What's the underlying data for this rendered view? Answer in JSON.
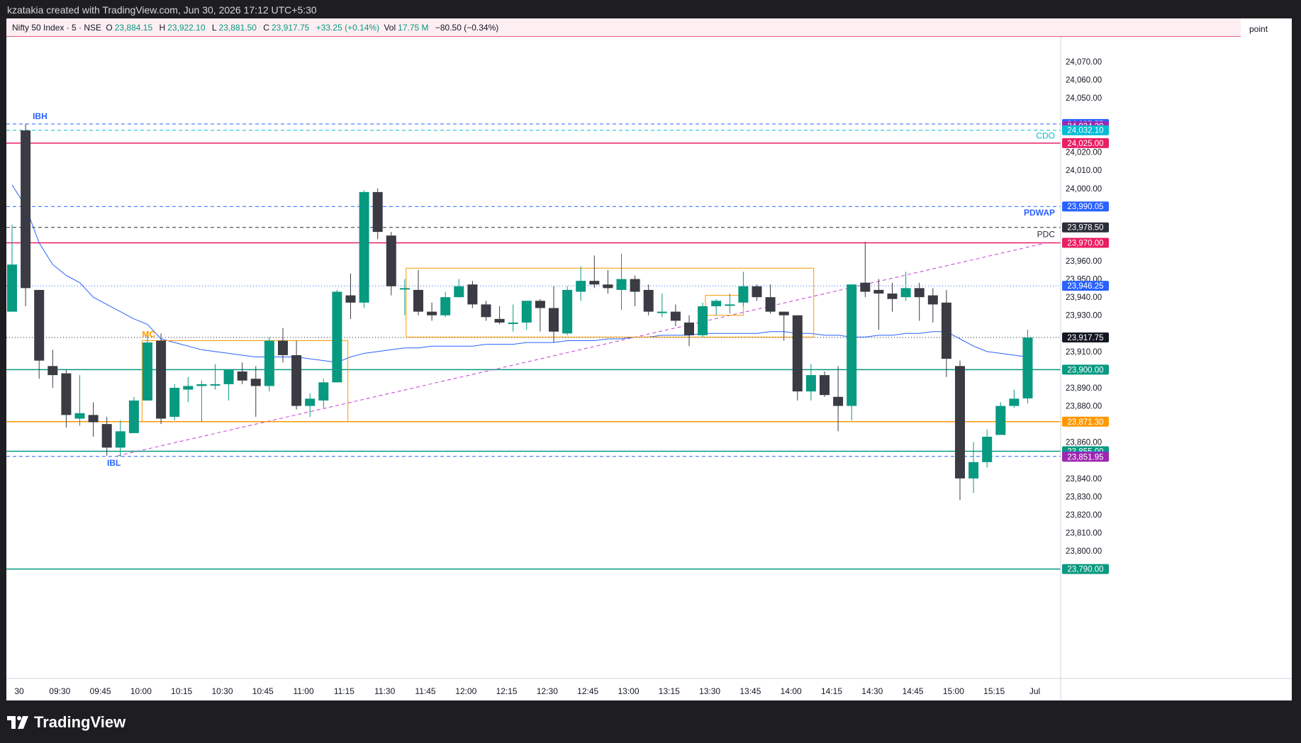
{
  "header": {
    "caption": "kzatakia created with TradingView.com, Jun 30, 2026 17:12 UTC+5:30"
  },
  "legend": {
    "symbol": "Nifty 50 Index · 5 · NSE",
    "o_label": "O",
    "o": "23,884.15",
    "h_label": "H",
    "h": "23,922.10",
    "l_label": "L",
    "l": "23,881.50",
    "c_label": "C",
    "c": "23,917.75",
    "change": "+33.25 (+0.14%)",
    "vol_label": "Vol",
    "vol": "17.75 M",
    "vol_change": "−80.50 (−0.34%)"
  },
  "axis_unit": "point",
  "brand": {
    "name": "TradingView"
  },
  "chart_data": {
    "type": "candlestick",
    "title": "Nifty 50 Index · 5 · NSE",
    "ylim": [
      23784,
      24084
    ],
    "y_ticks": [
      {
        "value": 24070,
        "label": "24,070.00"
      },
      {
        "value": 24060,
        "label": "24,060.00"
      },
      {
        "value": 24050,
        "label": "24,050.00"
      },
      {
        "value": 24020,
        "label": "24,020.00"
      },
      {
        "value": 24010,
        "label": "24,010.00"
      },
      {
        "value": 24000,
        "label": "24,000.00"
      },
      {
        "value": 23960,
        "label": "23,960.00"
      },
      {
        "value": 23950,
        "label": "23,950.00"
      },
      {
        "value": 23940,
        "label": "23,940.00"
      },
      {
        "value": 23930,
        "label": "23,930.00"
      },
      {
        "value": 23910,
        "label": "23,910.00"
      },
      {
        "value": 23890,
        "label": "23,890.00"
      },
      {
        "value": 23880,
        "label": "23,880.00"
      },
      {
        "value": 23860,
        "label": "23,860.00"
      },
      {
        "value": 23840,
        "label": "23,840.00"
      },
      {
        "value": 23830,
        "label": "23,830.00"
      },
      {
        "value": 23820,
        "label": "23,820.00"
      },
      {
        "value": 23810,
        "label": "23,810.00"
      },
      {
        "value": 23800,
        "label": "23,800.00"
      }
    ],
    "x_ticks": [
      {
        "index": 0,
        "label": "30"
      },
      {
        "index": 3,
        "label": "09:30"
      },
      {
        "index": 6,
        "label": "09:45"
      },
      {
        "index": 9,
        "label": "10:00"
      },
      {
        "index": 12,
        "label": "10:15"
      },
      {
        "index": 15,
        "label": "10:30"
      },
      {
        "index": 18,
        "label": "10:45"
      },
      {
        "index": 21,
        "label": "11:00"
      },
      {
        "index": 24,
        "label": "11:15"
      },
      {
        "index": 27,
        "label": "11:30"
      },
      {
        "index": 30,
        "label": "11:45"
      },
      {
        "index": 33,
        "label": "12:00"
      },
      {
        "index": 36,
        "label": "12:15"
      },
      {
        "index": 39,
        "label": "12:30"
      },
      {
        "index": 42,
        "label": "12:45"
      },
      {
        "index": 45,
        "label": "13:00"
      },
      {
        "index": 48,
        "label": "13:15"
      },
      {
        "index": 51,
        "label": "13:30"
      },
      {
        "index": 54,
        "label": "13:45"
      },
      {
        "index": 57,
        "label": "14:00"
      },
      {
        "index": 60,
        "label": "14:15"
      },
      {
        "index": 63,
        "label": "14:30"
      },
      {
        "index": 66,
        "label": "14:45"
      },
      {
        "index": 69,
        "label": "15:00"
      },
      {
        "index": 72,
        "label": "15:15"
      },
      {
        "index": 75,
        "label": "Jul"
      }
    ],
    "candles": [
      {
        "t": "09:15",
        "o": 23932,
        "h": 23980,
        "l": 23932,
        "c": 23958
      },
      {
        "t": "09:20",
        "o": 24032,
        "h": 24035.55,
        "l": 23935,
        "c": 23945
      },
      {
        "t": "09:25",
        "o": 23944,
        "h": 23944,
        "l": 23895,
        "c": 23905
      },
      {
        "t": "09:30",
        "o": 23902,
        "h": 23911,
        "l": 23890,
        "c": 23897
      },
      {
        "t": "09:35",
        "o": 23898,
        "h": 23900,
        "l": 23868,
        "c": 23875
      },
      {
        "t": "09:40",
        "o": 23873,
        "h": 23897,
        "l": 23869,
        "c": 23876
      },
      {
        "t": "09:45",
        "o": 23875,
        "h": 23882,
        "l": 23863,
        "c": 23871
      },
      {
        "t": "09:50",
        "o": 23870,
        "h": 23874,
        "l": 23852.5,
        "c": 23857
      },
      {
        "t": "09:55",
        "o": 23857,
        "h": 23872,
        "l": 23851.95,
        "c": 23866
      },
      {
        "t": "10:00",
        "o": 23865,
        "h": 23885,
        "l": 23865,
        "c": 23883
      },
      {
        "t": "10:05",
        "o": 23883,
        "h": 23919,
        "l": 23883,
        "c": 23915
      },
      {
        "t": "10:10",
        "o": 23916,
        "h": 23920,
        "l": 23870,
        "c": 23873
      },
      {
        "t": "10:15",
        "o": 23874,
        "h": 23892,
        "l": 23872,
        "c": 23890
      },
      {
        "t": "10:20",
        "o": 23889,
        "h": 23896,
        "l": 23882,
        "c": 23891
      },
      {
        "t": "10:25",
        "o": 23891,
        "h": 23894,
        "l": 23871.3,
        "c": 23892
      },
      {
        "t": "10:30",
        "o": 23892,
        "h": 23903,
        "l": 23889,
        "c": 23892
      },
      {
        "t": "10:35",
        "o": 23892,
        "h": 23900,
        "l": 23883,
        "c": 23900
      },
      {
        "t": "10:40",
        "o": 23899,
        "h": 23904,
        "l": 23892,
        "c": 23894
      },
      {
        "t": "10:45",
        "o": 23895,
        "h": 23902,
        "l": 23874,
        "c": 23891
      },
      {
        "t": "10:50",
        "o": 23891,
        "h": 23918,
        "l": 23888,
        "c": 23916
      },
      {
        "t": "10:55",
        "o": 23916,
        "h": 23923,
        "l": 23904,
        "c": 23908
      },
      {
        "t": "11:00",
        "o": 23908,
        "h": 23916,
        "l": 23878,
        "c": 23880
      },
      {
        "t": "11:05",
        "o": 23880,
        "h": 23887,
        "l": 23874,
        "c": 23884
      },
      {
        "t": "11:10",
        "o": 23883,
        "h": 23895,
        "l": 23879,
        "c": 23893
      },
      {
        "t": "11:15",
        "o": 23893,
        "h": 23944,
        "l": 23893,
        "c": 23943
      },
      {
        "t": "11:20",
        "o": 23941,
        "h": 23953,
        "l": 23928,
        "c": 23937
      },
      {
        "t": "11:25",
        "o": 23937,
        "h": 23999,
        "l": 23934,
        "c": 23998
      },
      {
        "t": "11:30",
        "o": 23998,
        "h": 24000,
        "l": 23972,
        "c": 23976
      },
      {
        "t": "11:35",
        "o": 23974,
        "h": 23976,
        "l": 23941,
        "c": 23946
      },
      {
        "t": "11:40",
        "o": 23945,
        "h": 23950,
        "l": 23930,
        "c": 23945
      },
      {
        "t": "11:45",
        "o": 23944,
        "h": 23955,
        "l": 23930,
        "c": 23932
      },
      {
        "t": "11:50",
        "o": 23932,
        "h": 23937,
        "l": 23927,
        "c": 23930
      },
      {
        "t": "11:55",
        "o": 23930,
        "h": 23943,
        "l": 23929,
        "c": 23940
      },
      {
        "t": "12:00",
        "o": 23940,
        "h": 23950,
        "l": 23940,
        "c": 23946
      },
      {
        "t": "12:05",
        "o": 23947,
        "h": 23949,
        "l": 23934,
        "c": 23936
      },
      {
        "t": "12:10",
        "o": 23936,
        "h": 23938,
        "l": 23927,
        "c": 23929
      },
      {
        "t": "12:15",
        "o": 23928,
        "h": 23935,
        "l": 23925,
        "c": 23926
      },
      {
        "t": "12:20",
        "o": 23926,
        "h": 23936,
        "l": 23921,
        "c": 23926
      },
      {
        "t": "12:25",
        "o": 23926,
        "h": 23937,
        "l": 23922,
        "c": 23938
      },
      {
        "t": "12:30",
        "o": 23938,
        "h": 23939,
        "l": 23921,
        "c": 23934
      },
      {
        "t": "12:35",
        "o": 23934,
        "h": 23946,
        "l": 23915,
        "c": 23921
      },
      {
        "t": "12:40",
        "o": 23920,
        "h": 23946,
        "l": 23919,
        "c": 23944
      },
      {
        "t": "12:45",
        "o": 23943,
        "h": 23957,
        "l": 23938,
        "c": 23949
      },
      {
        "t": "12:50",
        "o": 23949,
        "h": 23963,
        "l": 23945,
        "c": 23947
      },
      {
        "t": "12:55",
        "o": 23947,
        "h": 23955,
        "l": 23942,
        "c": 23945
      },
      {
        "t": "13:00",
        "o": 23944,
        "h": 23964,
        "l": 23933,
        "c": 23950
      },
      {
        "t": "13:05",
        "o": 23950,
        "h": 23952,
        "l": 23935,
        "c": 23943
      },
      {
        "t": "13:10",
        "o": 23944,
        "h": 23947,
        "l": 23930,
        "c": 23932
      },
      {
        "t": "13:15",
        "o": 23932,
        "h": 23942,
        "l": 23929,
        "c": 23932
      },
      {
        "t": "13:20",
        "o": 23932,
        "h": 23936,
        "l": 23924,
        "c": 23927
      },
      {
        "t": "13:25",
        "o": 23926,
        "h": 23930,
        "l": 23913,
        "c": 23919
      },
      {
        "t": "13:30",
        "o": 23919,
        "h": 23937,
        "l": 23918,
        "c": 23935
      },
      {
        "t": "13:35",
        "o": 23935,
        "h": 23939,
        "l": 23930,
        "c": 23938
      },
      {
        "t": "13:40",
        "o": 23936,
        "h": 23942,
        "l": 23931,
        "c": 23936
      },
      {
        "t": "13:45",
        "o": 23937,
        "h": 23954,
        "l": 23935,
        "c": 23946
      },
      {
        "t": "13:50",
        "o": 23946,
        "h": 23947,
        "l": 23938,
        "c": 23940
      },
      {
        "t": "13:55",
        "o": 23940,
        "h": 23947,
        "l": 23931,
        "c": 23932
      },
      {
        "t": "14:00",
        "o": 23932,
        "h": 23932,
        "l": 23916,
        "c": 23930
      },
      {
        "t": "14:05",
        "o": 23930,
        "h": 23930,
        "l": 23883,
        "c": 23888
      },
      {
        "t": "14:10",
        "o": 23888,
        "h": 23903,
        "l": 23883,
        "c": 23897
      },
      {
        "t": "14:15",
        "o": 23897,
        "h": 23899,
        "l": 23885,
        "c": 23886
      },
      {
        "t": "14:20",
        "o": 23885,
        "h": 23902,
        "l": 23866,
        "c": 23880
      },
      {
        "t": "14:25",
        "o": 23880,
        "h": 23947,
        "l": 23872,
        "c": 23947
      },
      {
        "t": "14:30",
        "o": 23948,
        "h": 23970.5,
        "l": 23940,
        "c": 23943
      },
      {
        "t": "14:35",
        "o": 23944,
        "h": 23950,
        "l": 23922,
        "c": 23942
      },
      {
        "t": "14:40",
        "o": 23942,
        "h": 23948,
        "l": 23932,
        "c": 23939
      },
      {
        "t": "14:45",
        "o": 23940,
        "h": 23954,
        "l": 23938,
        "c": 23945
      },
      {
        "t": "14:50",
        "o": 23945,
        "h": 23948,
        "l": 23927,
        "c": 23940
      },
      {
        "t": "14:55",
        "o": 23941,
        "h": 23945,
        "l": 23926,
        "c": 23936
      },
      {
        "t": "15:00",
        "o": 23937,
        "h": 23944,
        "l": 23896,
        "c": 23906
      },
      {
        "t": "15:05",
        "o": 23902,
        "h": 23905,
        "l": 23828,
        "c": 23840
      },
      {
        "t": "15:10",
        "o": 23840,
        "h": 23860,
        "l": 23832,
        "c": 23849
      },
      {
        "t": "15:15",
        "o": 23849,
        "h": 23867,
        "l": 23846,
        "c": 23863
      },
      {
        "t": "15:20",
        "o": 23864,
        "h": 23882,
        "l": 23864,
        "c": 23880
      },
      {
        "t": "15:25",
        "o": 23880,
        "h": 23889,
        "l": 23879,
        "c": 23884
      },
      {
        "t": "15:30",
        "o": 23884.15,
        "h": 23922.1,
        "l": 23881.5,
        "c": 23917.75
      }
    ],
    "vwap": [
      24002,
      23990,
      23970,
      23958,
      23952,
      23948,
      23940,
      23936,
      23932,
      23928,
      23925,
      23917,
      23915,
      23913,
      23911,
      23910,
      23909,
      23908,
      23907,
      23907,
      23907,
      23907,
      23906,
      23905,
      23904,
      23907,
      23909,
      23910,
      23911,
      23912,
      23912,
      23913,
      23913,
      23913,
      23913,
      23914,
      23914,
      23914,
      23915,
      23915,
      23915,
      23916,
      23916,
      23916,
      23917,
      23917,
      23918,
      23918,
      23919,
      23919,
      23919,
      23920,
      23920,
      23920,
      23920,
      23920,
      23921,
      23921,
      23920,
      23920,
      23919,
      23919,
      23918,
      23918,
      23919,
      23919,
      23920,
      23920,
      23921,
      23921,
      23917,
      23913,
      23910,
      23909,
      23908,
      23907
    ],
    "levels": [
      {
        "name": "IBH",
        "value": 24035.55,
        "label": "24,035.55",
        "color": "#2962ff",
        "style": "dashed"
      },
      {
        "name": "",
        "value": 24034.3,
        "label": "24,034.30",
        "color": "#9c27b0",
        "style": "none"
      },
      {
        "name": "CDO",
        "value": 24032.1,
        "label": "24,032.10",
        "color": "#00bcd4",
        "style": "dashed"
      },
      {
        "name": "",
        "value": 24025.0,
        "label": "24,025.00",
        "color": "#e91e63",
        "style": "solid"
      },
      {
        "name": "PDWAP",
        "value": 23990.05,
        "label": "23,990.05",
        "color": "#2962ff",
        "style": "dashed"
      },
      {
        "name": "PDC",
        "value": 23978.5,
        "label": "23,978.50",
        "color": "#2a2e39",
        "style": "dashed"
      },
      {
        "name": "",
        "value": 23970.0,
        "label": "23,970.00",
        "color": "#e91e63",
        "style": "solid"
      },
      {
        "name": "",
        "value": 23946.25,
        "label": "23,946.25",
        "color": "#2962ff",
        "style": "dotted"
      },
      {
        "name": "",
        "value": 23917.75,
        "label": "23,917.75",
        "color": "#131722",
        "style": "dotted"
      },
      {
        "name": "",
        "value": 23900.0,
        "label": "23,900.00",
        "color": "#089981",
        "style": "solid"
      },
      {
        "name": "",
        "value": 23871.3,
        "label": "23,871.30",
        "color": "#ff9800",
        "style": "solid"
      },
      {
        "name": "",
        "value": 23855.0,
        "label": "23,855.00",
        "color": "#089981",
        "style": "solid"
      },
      {
        "name": "IBL",
        "value": 23852.15,
        "label": "23,852.15",
        "color": "#2962ff",
        "style": "dashed"
      },
      {
        "name": "",
        "value": 23851.95,
        "label": "23,851.95",
        "color": "#9c27b0",
        "style": "none"
      },
      {
        "name": "",
        "value": 23790.0,
        "label": "23,790.00",
        "color": "#089981",
        "style": "solid"
      }
    ],
    "boxes": [
      {
        "name": "MC",
        "i0": 9.6,
        "i1": 24.8,
        "top": 23916,
        "bottom": 23871.3,
        "color": "#ff9800"
      },
      {
        "name": "",
        "i0": 29.1,
        "i1": 59.2,
        "top": 23956,
        "bottom": 23918,
        "color": "#ff9800"
      },
      {
        "name": "",
        "i0": 51.2,
        "i1": 54.0,
        "top": 23941,
        "bottom": 23930,
        "color": "#ff9800"
      }
    ],
    "trendline": {
      "i0": 7.8,
      "v0": 23852.5,
      "i1": 76.4,
      "v1": 23970
    },
    "colors": {
      "up": "#089981",
      "down": "#3b3b44",
      "vwap": "#2962ff",
      "trend": "#c53ad6"
    },
    "grid": false
  }
}
